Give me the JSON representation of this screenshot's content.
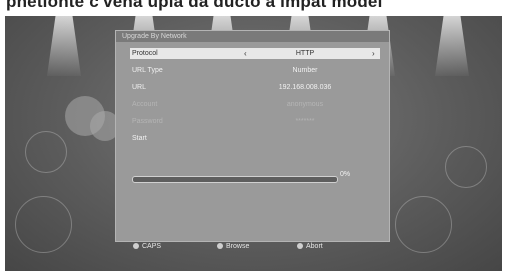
{
  "caption": {
    "text": "pnetionte c'vena upia da ducto a impat model"
  },
  "dialog": {
    "title": "Upgrade By Network",
    "rows": [
      {
        "label": "Protocol",
        "value": "HTTP",
        "state": "selected",
        "left_arrow": "‹",
        "right_arrow": "›"
      },
      {
        "label": "URL Type",
        "value": "Number",
        "state": "normal"
      },
      {
        "label": "URL",
        "value": "192.168.008.036",
        "state": "normal"
      },
      {
        "label": "Account",
        "value": "anonymous",
        "state": "dim"
      },
      {
        "label": "Password",
        "value": "*******",
        "state": "dim"
      },
      {
        "label": "Start",
        "value": "",
        "state": "normal"
      }
    ],
    "progress": {
      "percent": 0,
      "label": "0%"
    }
  },
  "footer": {
    "hints": [
      {
        "label": "CAPS",
        "color": "#cfcfcf"
      },
      {
        "label": "Browse",
        "color": "#cfcfcf"
      },
      {
        "label": "Abort",
        "color": "#cfcfcf"
      }
    ]
  }
}
